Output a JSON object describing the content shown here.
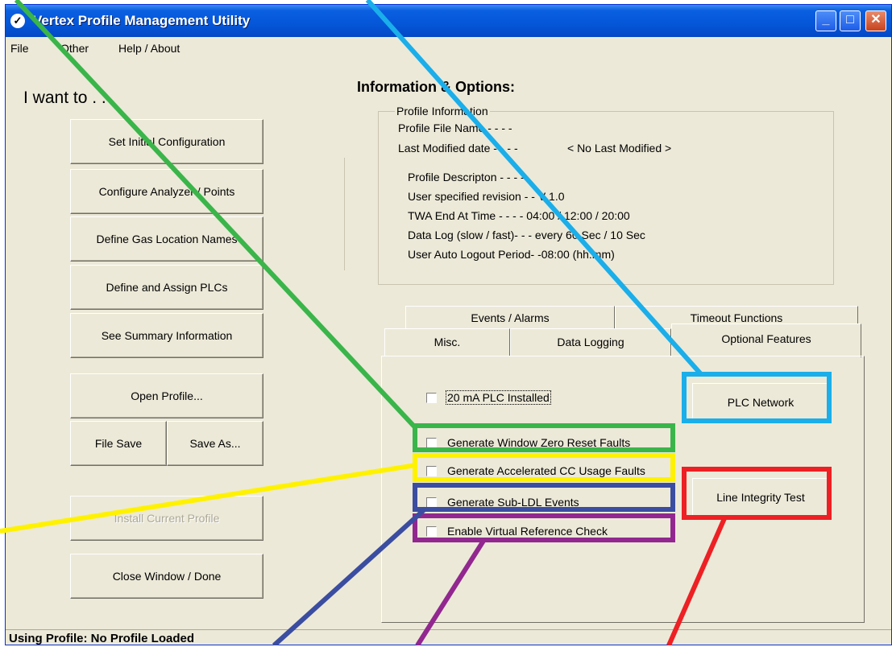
{
  "window": {
    "title": "Vertex Profile Management Utility"
  },
  "menu": {
    "file": "File",
    "other": "Other",
    "help": "Help / About"
  },
  "left": {
    "heading": "I want to . . .",
    "buttons": {
      "set_initial": "Set Initial Configuration",
      "configure": "Configure Analyzer / Points",
      "define_gas": "Define Gas Location Names",
      "define_plc": "Define and Assign PLCs",
      "summary": "See Summary Information",
      "open": "Open Profile...",
      "file_save": "File Save",
      "save_as": "Save As...",
      "install": "Install Current Profile",
      "close": "Close Window / Done"
    }
  },
  "info": {
    "title": "Information & Options:",
    "group_label": "Profile Information",
    "file_name": "Profile File Name - - - -",
    "last_modified_label": "Last Modified date - - - -",
    "last_modified_value": "< No Last Modified >",
    "description": "Profile Descripton - - - -",
    "revision": "User specified revision - - V 1.0",
    "twa": "TWA End At Time - - - - 04:00  /  12:00  /  20:00",
    "data_log": "Data  Log (slow / fast)- - - every 60 Sec / 10 Sec",
    "logout": "User Auto Logout Period- -08:00 (hh:mm)"
  },
  "tabs": {
    "events": "Events / Alarms",
    "timeout": "Timeout Functions",
    "misc": "Misc.",
    "data_logging": "Data Logging",
    "optional": "Optional Features"
  },
  "options": {
    "plc_20ma": "20 mA PLC Installed",
    "window_zero": "Generate Window Zero Reset Faults",
    "accelerated_cc": "Generate Accelerated CC Usage Faults",
    "sub_ldl": "Generate Sub-LDL Events",
    "virtual_ref": "Enable Virtual Reference Check",
    "plc_network": "PLC Network",
    "line_integrity": "Line Integrity Test"
  },
  "status": {
    "text": "Using Profile:  No Profile Loaded"
  },
  "highlight_colors": {
    "green": "#3ab54a",
    "yellow": "#fff200",
    "navy": "#3b4da0",
    "purple": "#92278f",
    "cyan": "#1aaeea",
    "red": "#ed2024"
  },
  "icons": [
    "app-icon",
    "minimize-icon",
    "maximize-icon",
    "close-icon"
  ]
}
